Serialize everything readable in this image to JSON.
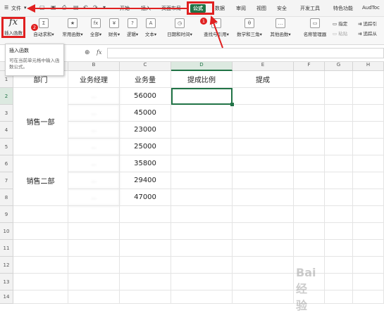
{
  "menu": {
    "file": "文件",
    "tabs": [
      "开始",
      "插入",
      "页面布局",
      "公式",
      "数据",
      "审阅",
      "视图",
      "安全",
      "开发工具",
      "特色功能",
      "AudToc"
    ],
    "active": "公式"
  },
  "quick_access": [
    "save-icon",
    "print-icon",
    "undo-icon",
    "redo-icon",
    "more-icon"
  ],
  "ribbon": {
    "insert_function": {
      "glyph": "fx",
      "label": "插入函数"
    },
    "buttons": [
      "自动求和▾",
      "常用函数▾",
      "全部▾",
      "财务▾",
      "逻辑▾",
      "文本▾",
      "日期和时间▾",
      "查找与引用▾",
      "数学和三角▾",
      "其他函数▾",
      "名称管理器"
    ],
    "right": [
      "指定",
      "粘贴",
      "追踪引",
      "追踪从"
    ]
  },
  "tooltip": {
    "title": "插入函数",
    "desc": "可在当前单元格中输入函数公式。"
  },
  "formula_bar": {
    "zoom_glyph": "⊕",
    "fx": "fx",
    "value": ""
  },
  "badges": [
    "1",
    "2"
  ],
  "columns": [
    "A",
    "B",
    "C",
    "D",
    "E",
    "F",
    "G",
    "H"
  ],
  "rows": [
    "1",
    "2",
    "3",
    "4",
    "5",
    "6",
    "7",
    "8",
    "9",
    "10",
    "11",
    "12",
    "13",
    "14"
  ],
  "table": {
    "headers": [
      "部门",
      "业务经理",
      "业务量",
      "提成比例",
      "提成"
    ],
    "dept1": "销售一部",
    "dept2": "销售二部",
    "volumes": [
      "56000",
      "45000",
      "23000",
      "25000",
      "35800",
      "29400",
      "47000"
    ],
    "blurred_names": [
      "…",
      "…",
      "…",
      "…",
      "…",
      "…",
      "…"
    ]
  },
  "watermark": "Bai 经验",
  "accent": "#217346",
  "highlight": "#e02020"
}
